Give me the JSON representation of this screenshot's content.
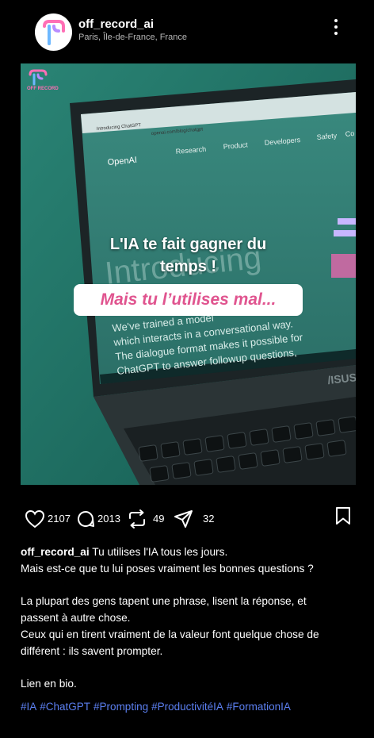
{
  "post": {
    "username": "off_record_ai",
    "location": "Paris, Île-de-France, France",
    "brand_logo_text": "OFF RECORD",
    "image": {
      "headline_line1": "L'IA te fait gagner du",
      "headline_line2": "temps !",
      "highlight": "Mais tu l’utilises mal...",
      "screen_tab": "Introducing ChatGPT",
      "screen_url": "openai.com/blog/chatgpt",
      "screen_logo": "OpenAI",
      "screen_nav": [
        "Research",
        "Product",
        "Developers",
        "Safety",
        "Co"
      ],
      "screen_big": "Introducing",
      "screen_body": [
        "We've trained a model",
        "which interacts in a conversational way.",
        "The dialogue format makes it possible for",
        "ChatGPT to answer followup questions,"
      ],
      "laptop_brand": "/ISUS"
    },
    "likes": "2107",
    "comments": "2013",
    "reposts": "49",
    "shares": "32",
    "caption_user": "off_record_ai",
    "caption_lines": [
      "Tu utilises l'IA tous les jours.",
      "Mais est-ce que tu lui poses vraiment les bonnes questions ?",
      "",
      "La plupart des gens tapent une phrase, lisent la réponse, et",
      "passent à autre chose.",
      "Ceux qui en tirent vraiment de la valeur font quelque chose de",
      "différent : ils savent prompter.",
      "",
      "Lien en bio."
    ],
    "hashtags": [
      "#IA",
      "#ChatGPT",
      "#Prompting",
      "#ProductivitéIA",
      "#FormationIA"
    ]
  },
  "colors": {
    "background": "#000000",
    "media_bg": "#1f6f63",
    "highlight_pink": "#e0548f",
    "hashtag_blue": "#5b7ff0"
  }
}
